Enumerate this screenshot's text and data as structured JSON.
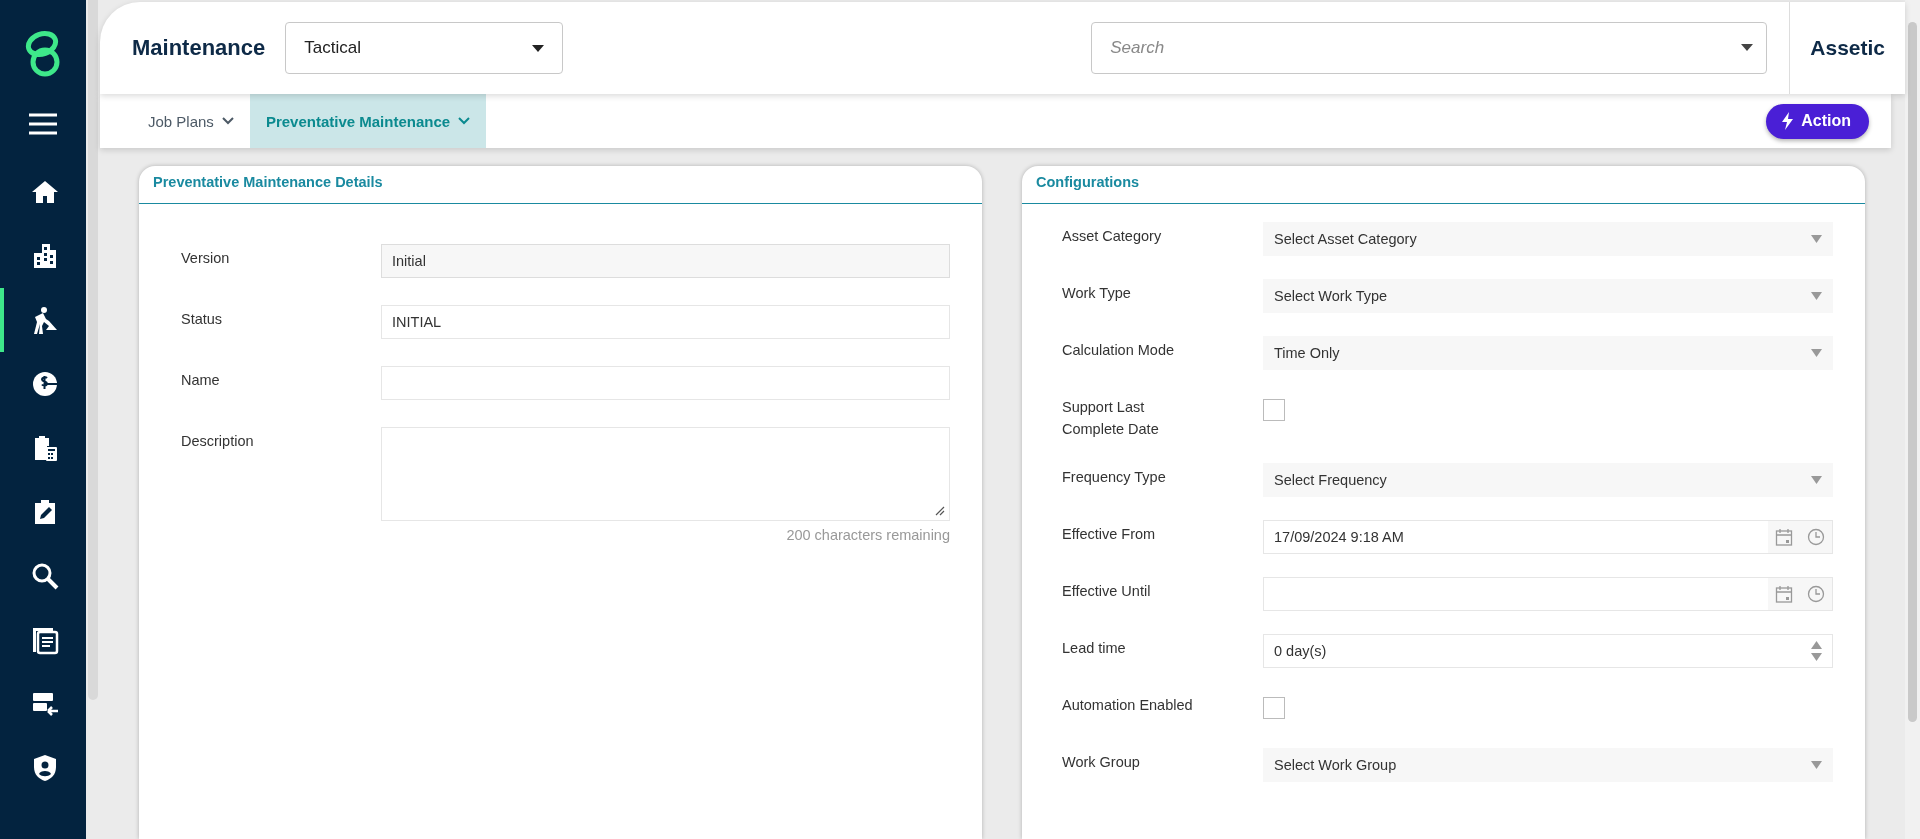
{
  "sidebar": {
    "items": [
      {
        "selected": false
      },
      {
        "selected": false
      },
      {
        "selected": true
      },
      {
        "selected": false
      },
      {
        "selected": false
      },
      {
        "selected": false
      },
      {
        "selected": false
      },
      {
        "selected": false
      },
      {
        "selected": false
      },
      {
        "selected": false
      }
    ]
  },
  "header": {
    "title": "Maintenance",
    "mode": {
      "value": "Tactical"
    },
    "search": {
      "placeholder": "Search"
    },
    "brand": "Assetic"
  },
  "tabs": [
    {
      "label": "Job Plans",
      "selected": false
    },
    {
      "label": "Preventative Maintenance",
      "selected": true
    }
  ],
  "action_button": "Action",
  "details": {
    "title": "Preventative Maintenance Details",
    "fields": [
      {
        "label": "Version",
        "kind": "readonly",
        "value": "Initial"
      },
      {
        "label": "Status",
        "kind": "text",
        "value": "INITIAL"
      },
      {
        "label": "Name",
        "kind": "text"
      },
      {
        "label": "Description",
        "kind": "textarea",
        "hint": "200 characters remaining"
      }
    ]
  },
  "configurations": {
    "title": "Configurations",
    "fields": [
      {
        "label": "Asset Category",
        "kind": "select",
        "value": "Select Asset Category"
      },
      {
        "label": "Work Type",
        "kind": "select",
        "value": "Select Work Type"
      },
      {
        "label": "Calculation Mode",
        "kind": "select",
        "value": "Time Only"
      },
      {
        "label": "Support Last Complete Date",
        "kind": "checkbox",
        "checked": false
      },
      {
        "label": "Frequency Type",
        "kind": "select",
        "value": "Select Frequency"
      },
      {
        "label": "Effective From",
        "kind": "datetime",
        "value": "17/09/2024 9:18 AM"
      },
      {
        "label": "Effective Until",
        "kind": "datetime"
      },
      {
        "label": "Lead time",
        "kind": "number",
        "value": "0 day(s)"
      },
      {
        "label": "Automation Enabled",
        "kind": "checkbox",
        "checked": false
      },
      {
        "label": "Work Group",
        "kind": "select",
        "value": "Select Work Group"
      }
    ]
  }
}
